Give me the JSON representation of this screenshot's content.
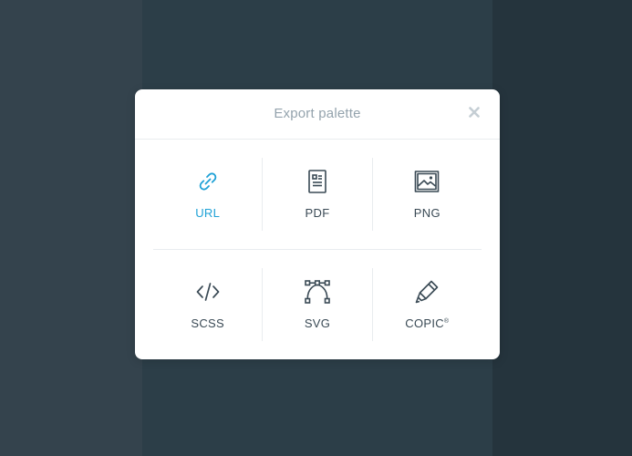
{
  "modal": {
    "title": "Export palette",
    "close_icon": "close-icon"
  },
  "options": [
    {
      "label": "URL",
      "icon": "link-icon",
      "active": true
    },
    {
      "label": "PDF",
      "icon": "document-icon",
      "active": false
    },
    {
      "label": "PNG",
      "icon": "image-icon",
      "active": false
    },
    {
      "label": "SCSS",
      "icon": "code-icon",
      "active": false
    },
    {
      "label": "SVG",
      "icon": "bezier-curve-icon",
      "active": false
    },
    {
      "label": "COPIC",
      "label_suffix": "®",
      "icon": "marker-icon",
      "active": false
    }
  ],
  "colors": {
    "accent": "#1ea1d6",
    "icon": "#3a4a55",
    "title": "#94a3ad",
    "backdrop": [
      "#34434d",
      "#2c3e48",
      "#25343d"
    ]
  }
}
